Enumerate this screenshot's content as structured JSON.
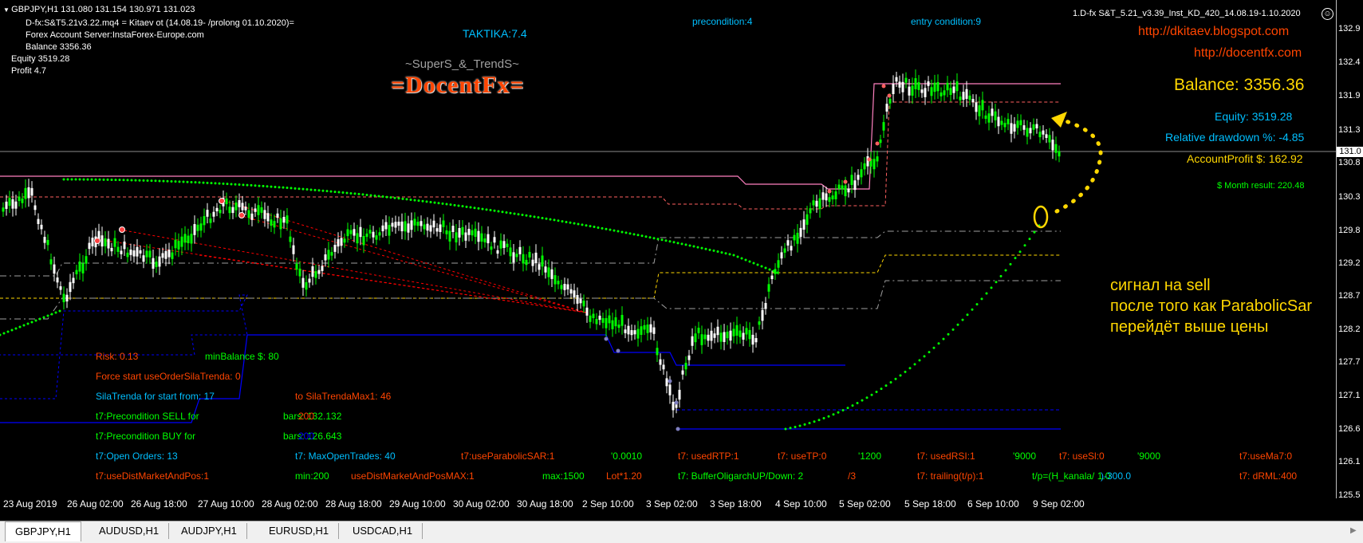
{
  "header": {
    "symbol_line": "GBPJPY,H1  131.080 131.154 130.971 131.023",
    "expert_line": "D-fx:S&T5.21v3.22.mq4 = Kitaev ot (14.08.19- /prolong 01.10.2020)=",
    "server_line": "Forex Account Server:InstaForex-Europe.com",
    "balance_line": "Balance  3356.36",
    "equity_line": "Equity  3519.28",
    "profit_line": "Profit  4.7",
    "taktika": "TAKTIKA:7.4",
    "precondition": "precondition:4",
    "entry_condition": "entry condition:9",
    "logo_top": "~SuperS_&_TrendS~",
    "logo_main": "=DocentFx=",
    "ea_title": "1.D-fx S&T_5.21_v3.39_Inst_KD_420_14.08.19-1.10.2020"
  },
  "right_panel": {
    "link1": "http://dkitaev.blogspot.com",
    "link2": "http://docentfx.com",
    "balance": "Balance: 3356.36",
    "equity": "Equity: 3519.28",
    "drawdown": "Relative drawdown %: -4.85",
    "account_profit": "AccountProfit $: 162.92",
    "month_result": "$ Month result: 220.48"
  },
  "annotation": {
    "line1": "сигнал на sell",
    "line2": "после того как ParabolicSar",
    "line3": "перейдёт выше цены"
  },
  "info_panel": {
    "risk": "Risk: 0.13",
    "min_balance": "minBalance $: 80",
    "force_start": "Force start useOrderSilaTrenda: 0",
    "sila_start": "SilaTrenda for start from: 17",
    "sila_max": "to SilaTrendaMax1: 46",
    "pre_sell": "t7:Precondition  SELL for",
    "pre_sell_val": "bars:  132.132",
    "pre_sell_overlay": "200",
    "pre_buy": "t7:Precondition  BUY  for",
    "pre_buy_val": "bars:  126.643",
    "pre_buy_overlay": "200"
  },
  "params_row1": [
    {
      "text": "t7:Open Orders: 13",
      "color": "#00bfff"
    },
    {
      "text": "t7: MaxOpenTrades: 40",
      "color": "#00bfff"
    },
    {
      "text": "t7:useParabolicSAR:1",
      "color": "#ff4500"
    },
    {
      "text": "'0.0010",
      "color": "#00ff00"
    },
    {
      "text": "t7: usedRTP:1",
      "color": "#ff4500"
    },
    {
      "text": "t7: useTP:0",
      "color": "#ff4500"
    },
    {
      "text": "'1200",
      "color": "#00ff00"
    },
    {
      "text": "t7: usedRSI:1",
      "color": "#ff4500"
    },
    {
      "text": "'9000",
      "color": "#00ff00"
    },
    {
      "text": "t7: useSl:0",
      "color": "#ff4500"
    },
    {
      "text": "'9000",
      "color": "#00ff00"
    },
    {
      "text": "t7:useMa7:0",
      "color": "#ff4500"
    }
  ],
  "params_row2": [
    {
      "text": "t7:useDistMarketAndPos:1",
      "color": "#ff4500"
    },
    {
      "text": "min:200",
      "color": "#00ff00"
    },
    {
      "text": "useDistMarketAndPosMAX:1",
      "color": "#ff4500"
    },
    {
      "text": "max:1500",
      "color": "#00ff00"
    },
    {
      "text": "Lot*1.20",
      "color": "#ff4500"
    },
    {
      "text": "t7: BufferOligarchUP/Down: 2",
      "color": "#00ff00"
    },
    {
      "text": "/3",
      "color": "#ff4500"
    },
    {
      "text": "t7: trailing(t/p):1",
      "color": "#ff4500"
    },
    {
      "text": "t/p=(H_kanala/ 1.0",
      "color": "#00ff00"
    },
    {
      "text": ")-300.0",
      "color": "#00bfff"
    },
    {
      "text": "t7: dRML:400",
      "color": "#ff4500"
    }
  ],
  "price_axis": {
    "ticks": [
      "132.9",
      "132.4",
      "131.9",
      "131.3",
      "130.8",
      "130.3",
      "129.8",
      "129.2",
      "128.7",
      "128.2",
      "127.7",
      "127.1",
      "126.6",
      "126.1",
      "125.5"
    ],
    "current": "131.0"
  },
  "time_axis": [
    "23 Aug 2019",
    "26 Aug 02:00",
    "26 Aug 18:00",
    "27 Aug 10:00",
    "28 Aug 02:00",
    "28 Aug 18:00",
    "29 Aug 10:00",
    "30 Aug 02:00",
    "30 Aug 18:00",
    "2 Sep 10:00",
    "3 Sep 02:00",
    "3 Sep 18:00",
    "4 Sep 10:00",
    "5 Sep 02:00",
    "5 Sep 18:00",
    "6 Sep 10:00",
    "9 Sep 02:00"
  ],
  "tabs": [
    "GBPJPY,H1",
    "AUDUSD,H1",
    "AUDJPY,H1",
    "EURUSD,H1",
    "USDCAD,H1"
  ],
  "colors": {
    "bull": "#00ff00",
    "bear": "#ffffff",
    "sar": "#00ff00",
    "channel_pink": "#ff80c0",
    "channel_yellow": "#ffd700",
    "channel_gray": "#a0a0a0",
    "channel_blue": "#0000ff",
    "red_dash": "#ff0000",
    "annotation": "#ffd700"
  }
}
